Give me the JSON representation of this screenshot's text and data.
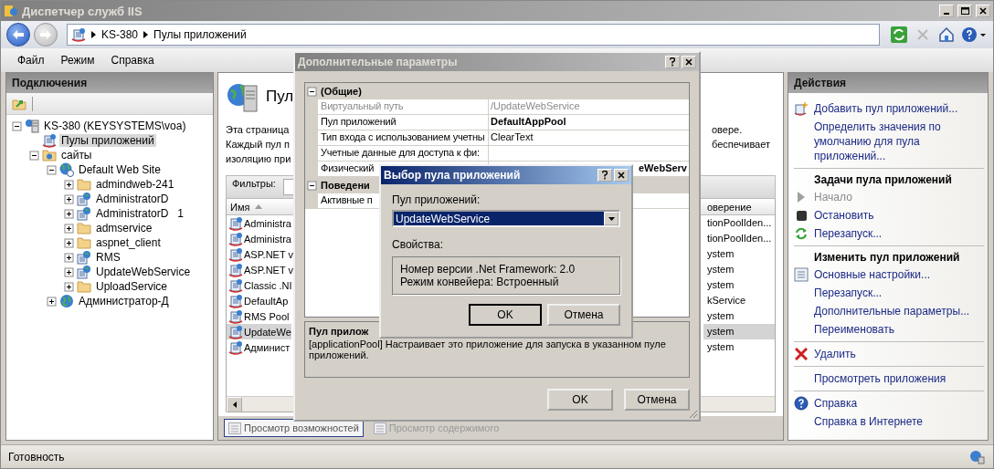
{
  "window": {
    "title": "Диспетчер служб IIS"
  },
  "address": {
    "crumbs": [
      "KS-380",
      "Пулы приложений"
    ]
  },
  "menu": [
    "Файл",
    "Режим",
    "Справка"
  ],
  "connections": {
    "title": "Подключения",
    "tree": [
      {
        "label": "KS-380 (KEYSYSTEMS\\voa)",
        "kind": "server",
        "expanded": true,
        "selected": false,
        "children": [
          {
            "label": "Пулы приложений",
            "kind": "pools",
            "selected": true
          },
          {
            "label": "сайты",
            "kind": "sites",
            "expanded": true,
            "selected": false,
            "children": [
              {
                "label": "Default Web Site",
                "kind": "site",
                "expanded": true,
                "selected": false,
                "children": [
                  {
                    "label": "admindweb-241",
                    "kind": "folder",
                    "expanded": false,
                    "selected": false
                  },
                  {
                    "label": "AdministratorD",
                    "kind": "app",
                    "expanded": false,
                    "selected": false
                  },
                  {
                    "label": "AdministratorD   1",
                    "kind": "app",
                    "expanded": false,
                    "selected": false
                  },
                  {
                    "label": "admservice",
                    "kind": "folder",
                    "expanded": false,
                    "selected": false
                  },
                  {
                    "label": "aspnet_client",
                    "kind": "folder",
                    "expanded": false,
                    "selected": false
                  },
                  {
                    "label": "RMS",
                    "kind": "app",
                    "expanded": false,
                    "selected": false
                  },
                  {
                    "label": "UpdateWebService",
                    "kind": "app",
                    "expanded": false,
                    "selected": false
                  },
                  {
                    "label": "UploadService",
                    "kind": "folder",
                    "expanded": false,
                    "selected": false
                  }
                ]
              },
              {
                "label": "Администратор-Д",
                "kind": "globe",
                "expanded": false,
                "selected": false
              }
            ]
          }
        ]
      }
    ]
  },
  "features": {
    "title": "Пул",
    "intro_left": [
      "Эта страница",
      "Каждый пул п",
      "изоляцию при"
    ],
    "intro_right": [
      "овере.",
      "беспечивает"
    ],
    "filter_label": "Фильтры:",
    "columns": [
      {
        "label": "Имя",
        "sorted": true
      },
      {
        "label": "оверение",
        "sorted": false
      }
    ],
    "rows": [
      {
        "name": "Administra",
        "identity": "tionPoolIden...",
        "selected": false
      },
      {
        "name": "Administra",
        "identity": "tionPoolIden...",
        "selected": false
      },
      {
        "name": "ASP.NET v",
        "identity": "ystem",
        "selected": false
      },
      {
        "name": "ASP.NET v",
        "identity": "ystem",
        "selected": false
      },
      {
        "name": "Classic .NI",
        "identity": "ystem",
        "selected": false
      },
      {
        "name": "DefaultAp",
        "identity": "kService",
        "selected": false
      },
      {
        "name": "RMS Pool",
        "identity": "ystem",
        "selected": false
      },
      {
        "name": "UpdateWe",
        "identity": "ystem",
        "selected": true
      },
      {
        "name": "Админист",
        "identity": "ystem",
        "selected": false
      }
    ],
    "views": [
      {
        "label": "Просмотр возможностей",
        "selected": true,
        "disabled": false
      },
      {
        "label": "Просмотр содержимого",
        "selected": false,
        "disabled": true
      }
    ]
  },
  "actions": {
    "title": "Действия",
    "groups": [
      {
        "items": [
          {
            "kind": "add",
            "text": "Добавить пул приложений...",
            "disabled": false
          },
          {
            "kind": "link",
            "text": "Определить значения по умолчанию для пула приложений...",
            "disabled": false
          }
        ]
      },
      {
        "items": [
          {
            "kind": "heading",
            "text": "Задачи пула приложений"
          },
          {
            "kind": "play",
            "text": "Начало",
            "disabled": true
          },
          {
            "kind": "stop",
            "text": "Остановить",
            "disabled": false
          },
          {
            "kind": "refresh",
            "text": "Перезапуск...",
            "disabled": false
          }
        ]
      },
      {
        "items": [
          {
            "kind": "heading",
            "text": "Изменить пул приложений"
          },
          {
            "kind": "settings",
            "text": "Основные настройки...",
            "disabled": false
          },
          {
            "kind": "link",
            "text": "Перезапуск...",
            "disabled": false
          },
          {
            "kind": "link",
            "text": "Дополнительные параметры...",
            "disabled": false
          },
          {
            "kind": "link",
            "text": "Переименовать",
            "disabled": false
          }
        ]
      },
      {
        "items": [
          {
            "kind": "delete",
            "text": "Удалить",
            "disabled": false
          }
        ]
      },
      {
        "items": [
          {
            "kind": "link",
            "text": "Просмотреть приложения",
            "disabled": false
          }
        ]
      },
      {
        "items": [
          {
            "kind": "help",
            "text": "Справка",
            "disabled": false
          },
          {
            "kind": "link",
            "text": "Справка в Интернете",
            "disabled": false
          }
        ]
      }
    ]
  },
  "status_bar": {
    "text": "Готовность"
  },
  "advanced_dialog": {
    "title": "Дополнительные параметры",
    "categories": [
      {
        "label": "(Общие)",
        "expanded": true,
        "rows": [
          {
            "name": "Виртуальный путь",
            "value": "/UpdateWebService",
            "readonly": true,
            "modified": false,
            "kind": "plain"
          },
          {
            "name": "Пул приложений",
            "value": "DefaultAppPool",
            "readonly": false,
            "modified": true,
            "kind": "plain"
          },
          {
            "name": "Тип входа с использованием учетны",
            "value": "ClearText",
            "readonly": false,
            "modified": false,
            "kind": "plain"
          },
          {
            "name": "Учетные данные для доступа к фи:",
            "readonly": false,
            "modified": false,
            "kind": "plain"
          },
          {
            "name": "Физический",
            "value": "eWebServ",
            "readonly": false,
            "modified": true,
            "kind": "covered"
          }
        ]
      },
      {
        "label": "Поведени",
        "expanded": true,
        "rows": [
          {
            "name": "Активные п",
            "readonly": false,
            "modified": false,
            "kind": "covered"
          }
        ]
      }
    ],
    "description": {
      "title": "Пул прилож",
      "text": "[applicationPool] Настраивает это приложение для запуска в указанном пуле приложений."
    },
    "buttons": [
      "OK",
      "Отмена"
    ]
  },
  "picker_dialog": {
    "title": "Выбор пула приложений",
    "label": "Пул приложений:",
    "value": "UpdateWebService",
    "properties_label": "Свойства:",
    "properties": [
      "Номер версии .Net Framework: 2.0",
      "Режим конвейера: Встроенный"
    ],
    "buttons": [
      {
        "label": "OK",
        "default": true
      },
      {
        "label": "Отмена",
        "default": false
      }
    ]
  }
}
